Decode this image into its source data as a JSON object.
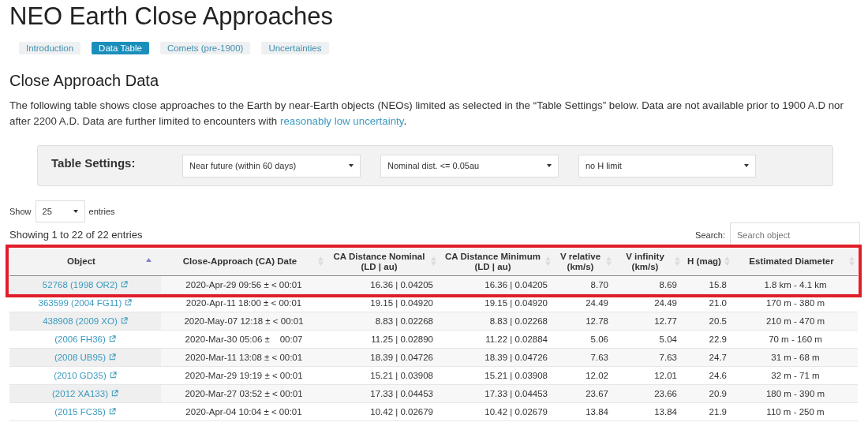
{
  "title": "NEO Earth Close Approaches",
  "tabs": [
    {
      "label": "Introduction",
      "selected": false
    },
    {
      "label": "Data Table",
      "selected": true
    },
    {
      "label": "Comets (pre-1900)",
      "selected": false
    },
    {
      "label": "Uncertainties",
      "selected": false
    }
  ],
  "section_title": "Close Approach Data",
  "description": {
    "text": "The following table shows close approaches to the Earth by near-Earth objects (NEOs) limited as selected in the “Table Settings” below. Data are not available prior to 1900 A.D nor after 2200 A.D. Data are further limited to encounters with ",
    "link": "reasonably low uncertainty",
    "after": "."
  },
  "table_settings": {
    "label": "Table Settings:",
    "selects": [
      "Near future (within 60 days)",
      "Nominal dist. <= 0.05au",
      "no H limit"
    ]
  },
  "length_control": {
    "before": "Show",
    "value": "25",
    "after": "entries"
  },
  "info": "Showing 1 to 22 of 22 entries",
  "search": {
    "label": "Search:",
    "placeholder": "Search object"
  },
  "table": {
    "columns": [
      {
        "label": "Object",
        "sorted": true
      },
      {
        "label": "Close-Approach (CA) Date",
        "sorted": false
      },
      {
        "label": "CA Distance Nominal (LD | au)",
        "sorted": false
      },
      {
        "label": "CA Distance Minimum (LD | au)",
        "sorted": false
      },
      {
        "label": "V relative (km/s)",
        "sorted": false
      },
      {
        "label": "V infinity (km/s)",
        "sorted": false
      },
      {
        "label": "H (mag)",
        "sorted": false
      },
      {
        "label": "Estimated Diameter",
        "sorted": false
      }
    ],
    "header_highlighted": true,
    "rows": [
      {
        "highlighted": true,
        "cells": [
          "52768 (1998 OR2)",
          "2020-Apr-29 09:56 ± < 00:01",
          "16.36 | 0.04205",
          "16.36 | 0.04205",
          "8.70",
          "8.69",
          "15.8",
          "1.8 km - 4.1 km"
        ]
      },
      {
        "highlighted": false,
        "cells": [
          "363599 (2004 FG11)",
          "2020-Apr-11 18:00 ± < 00:01",
          "19.15 | 0.04920",
          "19.15 | 0.04920",
          "24.49",
          "24.49",
          "21.0",
          "170 m - 380 m"
        ]
      },
      {
        "highlighted": false,
        "cells": [
          "438908 (2009 XO)",
          "2020-May-07 12:18 ± < 00:01",
          "8.83 | 0.02268",
          "8.83 | 0.02268",
          "12.78",
          "12.77",
          "20.5",
          "210 m - 470 m"
        ]
      },
      {
        "highlighted": false,
        "cells": [
          "(2006 FH36)",
          "2020-Mar-30 05:06 ±    00:07",
          "11.25 | 0.02890",
          "11.22 | 0.02884",
          "5.06",
          "5.04",
          "22.9",
          "70 m - 160 m"
        ]
      },
      {
        "highlighted": false,
        "cells": [
          "(2008 UB95)",
          "2020-Mar-11 13:08 ± < 00:01",
          "18.39 | 0.04726",
          "18.39 | 0.04726",
          "7.63",
          "7.63",
          "24.7",
          "31 m - 68 m"
        ]
      },
      {
        "highlighted": false,
        "cells": [
          "(2010 GD35)",
          "2020-Mar-29 19:19 ± < 00:01",
          "15.21 | 0.03908",
          "15.21 | 0.03908",
          "12.02",
          "12.01",
          "24.6",
          "32 m - 71 m"
        ]
      },
      {
        "highlighted": false,
        "cells": [
          "(2012 XA133)",
          "2020-Mar-27 03:52 ± < 00:01",
          "17.33 | 0.04453",
          "17.33 | 0.04453",
          "23.67",
          "23.66",
          "20.9",
          "180 m - 390 m"
        ]
      },
      {
        "highlighted": false,
        "cells": [
          "(2015 FC35)",
          "2020-Apr-04 10:04 ± < 00:01",
          "10.42 | 0.02679",
          "10.42 | 0.02679",
          "13.84",
          "13.84",
          "21.9",
          "110 m - 250 m"
        ]
      }
    ]
  }
}
